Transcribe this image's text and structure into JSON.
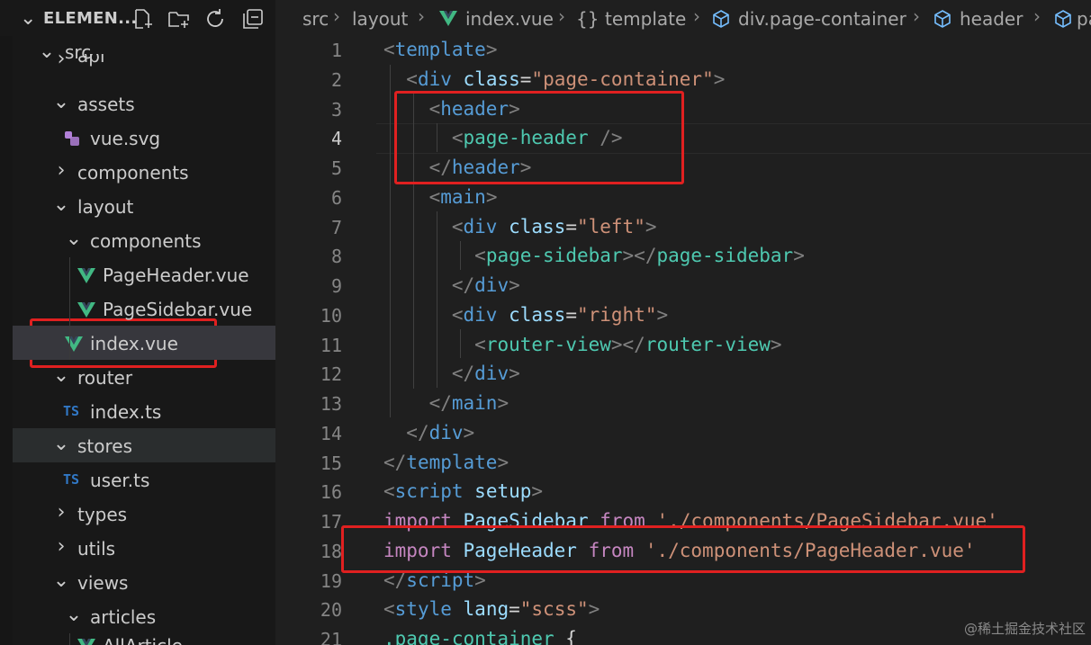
{
  "explorer": {
    "title": "ELEMEN...",
    "actions": [
      "new-file-icon",
      "new-folder-icon",
      "refresh-icon",
      "collapse-all-icon"
    ],
    "tree": [
      {
        "label": "src",
        "type": "folder",
        "open": true
      },
      {
        "label": "api",
        "type": "folder",
        "open": false
      },
      {
        "label": "assets",
        "type": "folder",
        "open": true
      },
      {
        "label": "vue.svg",
        "type": "svg"
      },
      {
        "label": "components",
        "type": "folder",
        "open": false
      },
      {
        "label": "layout",
        "type": "folder",
        "open": true
      },
      {
        "label": "components",
        "type": "folder",
        "open": true
      },
      {
        "label": "PageHeader.vue",
        "type": "vue"
      },
      {
        "label": "PageSidebar.vue",
        "type": "vue"
      },
      {
        "label": "index.vue",
        "type": "vue",
        "selected": true
      },
      {
        "label": "router",
        "type": "folder",
        "open": true
      },
      {
        "label": "index.ts",
        "type": "ts"
      },
      {
        "label": "stores",
        "type": "folder",
        "open": true
      },
      {
        "label": "user.ts",
        "type": "ts"
      },
      {
        "label": "types",
        "type": "folder",
        "open": false
      },
      {
        "label": "utils",
        "type": "folder",
        "open": false
      },
      {
        "label": "views",
        "type": "folder",
        "open": true
      },
      {
        "label": "articles",
        "type": "folder",
        "open": true
      },
      {
        "label": "AllArticle...",
        "type": "vue"
      }
    ],
    "ts_badge": "TS"
  },
  "breadcrumb": {
    "items": [
      "src",
      "layout",
      "index.vue",
      "template",
      "div.page-container",
      "header",
      "pa"
    ],
    "braces": "{}"
  },
  "editor": {
    "current_line": 4,
    "lines": [
      {
        "n": 1,
        "tokens": [
          [
            "p",
            "<"
          ],
          [
            "tag",
            "template"
          ],
          [
            "p",
            ">"
          ]
        ]
      },
      {
        "n": 2,
        "tokens": [
          [
            "t",
            "  "
          ],
          [
            "p",
            "<"
          ],
          [
            "tag",
            "div"
          ],
          [
            "t",
            " "
          ],
          [
            "attr",
            "class"
          ],
          [
            "t",
            "="
          ],
          [
            "str",
            "\"page-container\""
          ],
          [
            "p",
            ">"
          ]
        ]
      },
      {
        "n": 3,
        "tokens": [
          [
            "t",
            "    "
          ],
          [
            "p",
            "<"
          ],
          [
            "tag",
            "header"
          ],
          [
            "p",
            ">"
          ]
        ]
      },
      {
        "n": 4,
        "tokens": [
          [
            "t",
            "      "
          ],
          [
            "p",
            "<"
          ],
          [
            "comp",
            "page-header"
          ],
          [
            "t",
            " "
          ],
          [
            "p",
            "/>"
          ]
        ]
      },
      {
        "n": 5,
        "tokens": [
          [
            "t",
            "    "
          ],
          [
            "p",
            "</"
          ],
          [
            "tag",
            "header"
          ],
          [
            "p",
            ">"
          ]
        ]
      },
      {
        "n": 6,
        "tokens": [
          [
            "t",
            "    "
          ],
          [
            "p",
            "<"
          ],
          [
            "tag",
            "main"
          ],
          [
            "p",
            ">"
          ]
        ]
      },
      {
        "n": 7,
        "tokens": [
          [
            "t",
            "      "
          ],
          [
            "p",
            "<"
          ],
          [
            "tag",
            "div"
          ],
          [
            "t",
            " "
          ],
          [
            "attr",
            "class"
          ],
          [
            "t",
            "="
          ],
          [
            "str",
            "\"left\""
          ],
          [
            "p",
            ">"
          ]
        ]
      },
      {
        "n": 8,
        "tokens": [
          [
            "t",
            "        "
          ],
          [
            "p",
            "<"
          ],
          [
            "comp",
            "page-sidebar"
          ],
          [
            "p",
            "></"
          ],
          [
            "comp",
            "page-sidebar"
          ],
          [
            "p",
            ">"
          ]
        ]
      },
      {
        "n": 9,
        "tokens": [
          [
            "t",
            "      "
          ],
          [
            "p",
            "</"
          ],
          [
            "tag",
            "div"
          ],
          [
            "p",
            ">"
          ]
        ]
      },
      {
        "n": 10,
        "tokens": [
          [
            "t",
            "      "
          ],
          [
            "p",
            "<"
          ],
          [
            "tag",
            "div"
          ],
          [
            "t",
            " "
          ],
          [
            "attr",
            "class"
          ],
          [
            "t",
            "="
          ],
          [
            "str",
            "\"right\""
          ],
          [
            "p",
            ">"
          ]
        ]
      },
      {
        "n": 11,
        "tokens": [
          [
            "t",
            "        "
          ],
          [
            "p",
            "<"
          ],
          [
            "comp",
            "router-view"
          ],
          [
            "p",
            "></"
          ],
          [
            "comp",
            "router-view"
          ],
          [
            "p",
            ">"
          ]
        ]
      },
      {
        "n": 12,
        "tokens": [
          [
            "t",
            "      "
          ],
          [
            "p",
            "</"
          ],
          [
            "tag",
            "div"
          ],
          [
            "p",
            ">"
          ]
        ]
      },
      {
        "n": 13,
        "tokens": [
          [
            "t",
            "    "
          ],
          [
            "p",
            "</"
          ],
          [
            "tag",
            "main"
          ],
          [
            "p",
            ">"
          ]
        ]
      },
      {
        "n": 14,
        "tokens": [
          [
            "t",
            "  "
          ],
          [
            "p",
            "</"
          ],
          [
            "tag",
            "div"
          ],
          [
            "p",
            ">"
          ]
        ]
      },
      {
        "n": 15,
        "tokens": [
          [
            "p",
            "</"
          ],
          [
            "tag",
            "template"
          ],
          [
            "p",
            ">"
          ]
        ]
      },
      {
        "n": 16,
        "tokens": [
          [
            "p",
            "<"
          ],
          [
            "tag",
            "script"
          ],
          [
            "t",
            " "
          ],
          [
            "attr",
            "setup"
          ],
          [
            "p",
            ">"
          ]
        ]
      },
      {
        "n": 17,
        "tokens": [
          [
            "kw",
            "import"
          ],
          [
            "t",
            " "
          ],
          [
            "id",
            "PageSidebar"
          ],
          [
            "t",
            " "
          ],
          [
            "kw",
            "from"
          ],
          [
            "t",
            " "
          ],
          [
            "str",
            "'./components/PageSidebar.vue'"
          ]
        ]
      },
      {
        "n": 18,
        "tokens": [
          [
            "kw",
            "import"
          ],
          [
            "t",
            " "
          ],
          [
            "id",
            "PageHeader"
          ],
          [
            "t",
            " "
          ],
          [
            "kw",
            "from"
          ],
          [
            "t",
            " "
          ],
          [
            "str",
            "'./components/PageHeader.vue'"
          ]
        ]
      },
      {
        "n": 19,
        "tokens": [
          [
            "p",
            "</"
          ],
          [
            "tag",
            "script"
          ],
          [
            "p",
            ">"
          ]
        ]
      },
      {
        "n": 20,
        "tokens": [
          [
            "p",
            "<"
          ],
          [
            "tag",
            "style"
          ],
          [
            "t",
            " "
          ],
          [
            "attr",
            "lang"
          ],
          [
            "t",
            "="
          ],
          [
            "str",
            "\"scss\""
          ],
          [
            "p",
            ">"
          ]
        ]
      },
      {
        "n": 21,
        "tokens": [
          [
            "comp",
            ".page-container"
          ],
          [
            "t",
            " {"
          ]
        ]
      }
    ]
  },
  "watermark": "@稀土掘金技术社区",
  "colors": {
    "highlight_box": "#e02020",
    "vue_green": "#41b883",
    "ts_blue": "#3178c6"
  }
}
